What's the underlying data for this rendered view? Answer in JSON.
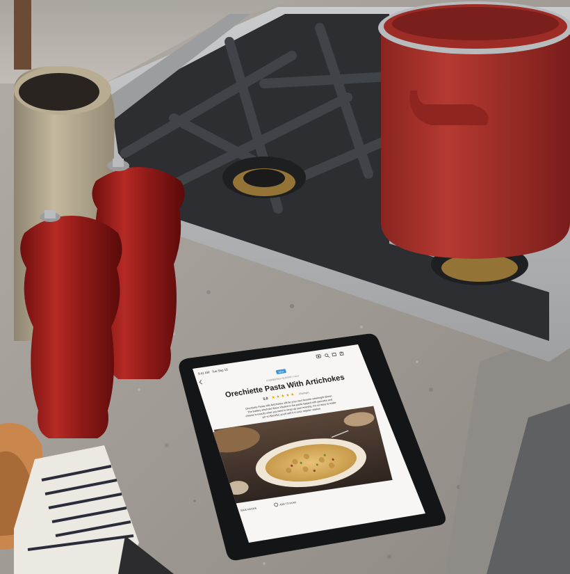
{
  "scene": {
    "objects": [
      "stone-crock",
      "pepper-mill",
      "salt-mill",
      "gas-stovetop",
      "red-stockpot",
      "tablet",
      "bread-basket"
    ],
    "colors": {
      "countertop": "#a19c95",
      "mill_red": "#9a1d1a",
      "pot_red": "#a8332c",
      "grate": "#2f3134",
      "steel": "#b4b6b7",
      "crock": "#b3a68c",
      "tablet_bezel": "#141517",
      "screen_bg": "#f7f6f4",
      "accent_badge": "#3d8fd6",
      "star_color": "#e8a800"
    }
  },
  "tablet": {
    "status": {
      "time": "9:41 AM",
      "date": "Tue Sep 10"
    },
    "badge": "NEW",
    "breadcrumb": "COOKBOOKS / EUROPE / ITALY",
    "title": "Orechiette Pasta With Artichokes",
    "rating": {
      "value": "5.0",
      "stars": 5,
      "count": "(Ratings)"
    },
    "description": "Orechiette Pasta with Artichokes will be your next favorite weeknight dinner. The buttery artichoke flavor infused in the pasta topped with pancetta and cheese is exactly what you need to wrap up your evening. It's so easy to make yet so flavorful, you'll add it to your regular rotation.",
    "actions": {
      "save_label": "SAVE RECIPE",
      "plan_label": "ADD TO PLAN"
    },
    "toolbar_icons": [
      "camera-icon",
      "search-icon",
      "cart-icon",
      "share-icon"
    ]
  }
}
